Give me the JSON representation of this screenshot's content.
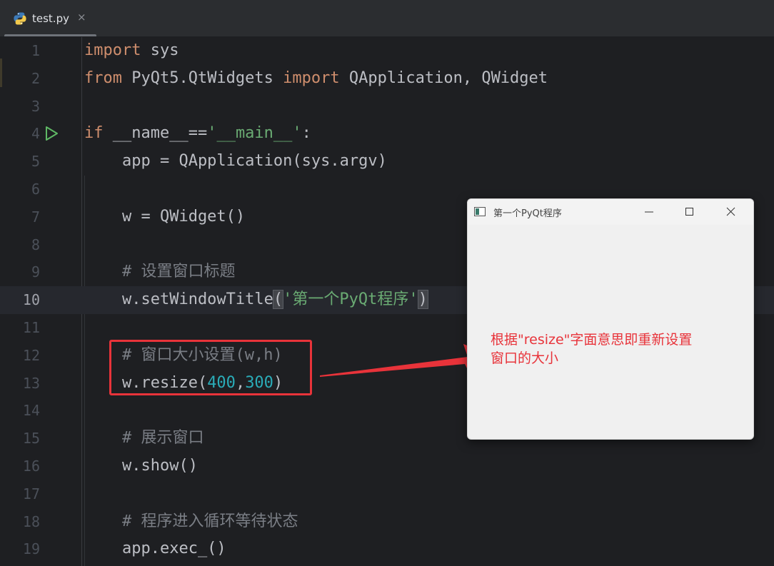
{
  "tab": {
    "filename": "test.py",
    "close_glyph": "×",
    "icon": "python-icon"
  },
  "lines": [
    {
      "n": "1"
    },
    {
      "n": "2"
    },
    {
      "n": "3"
    },
    {
      "n": "4"
    },
    {
      "n": "5"
    },
    {
      "n": "6"
    },
    {
      "n": "7"
    },
    {
      "n": "8"
    },
    {
      "n": "9"
    },
    {
      "n": "10"
    },
    {
      "n": "11"
    },
    {
      "n": "12"
    },
    {
      "n": "13"
    },
    {
      "n": "14"
    },
    {
      "n": "15"
    },
    {
      "n": "16"
    },
    {
      "n": "17"
    },
    {
      "n": "18"
    },
    {
      "n": "19"
    }
  ],
  "code": {
    "l1": {
      "a": "import",
      "b": " sys"
    },
    "l2": {
      "a": "from",
      "b": " PyQt5.QtWidgets ",
      "c": "import",
      "d": " QApplication, QWidget"
    },
    "l4": {
      "a": "if",
      "b": " __name__==",
      "c": "'__main__'",
      "d": ":"
    },
    "l5": {
      "a": "    app = QApplication(sys.argv)"
    },
    "l7": {
      "a": "    w = QWidget()"
    },
    "l9": {
      "a": "    # 设置窗口标题"
    },
    "l10": {
      "a": "    w.setWindowTitle",
      "b": "(",
      "c": "'第一个PyQt程序'",
      "d": ")"
    },
    "l12": {
      "a": "    # 窗口大小设置(w,h)"
    },
    "l13": {
      "a": "    w.resize(",
      "b": "400",
      "c": ",",
      "d": "300",
      "e": ")"
    },
    "l15": {
      "a": "    # 展示窗口"
    },
    "l16": {
      "a": "    w.show()"
    },
    "l18": {
      "a": "    # 程序进入循环等待状态"
    },
    "l19": {
      "a": "    app.exec_()"
    }
  },
  "popup": {
    "title": "第一个PyQt程序",
    "annotation_line1": "根据\"resize\"字面意思即重新设置",
    "annotation_line2": "窗口的大小"
  },
  "colors": {
    "keyword": "#cf8e6d",
    "string": "#6aab73",
    "number": "#2aacb8",
    "comment": "#7a7e85",
    "annotation": "#e8333a",
    "run": "#5fb865"
  }
}
